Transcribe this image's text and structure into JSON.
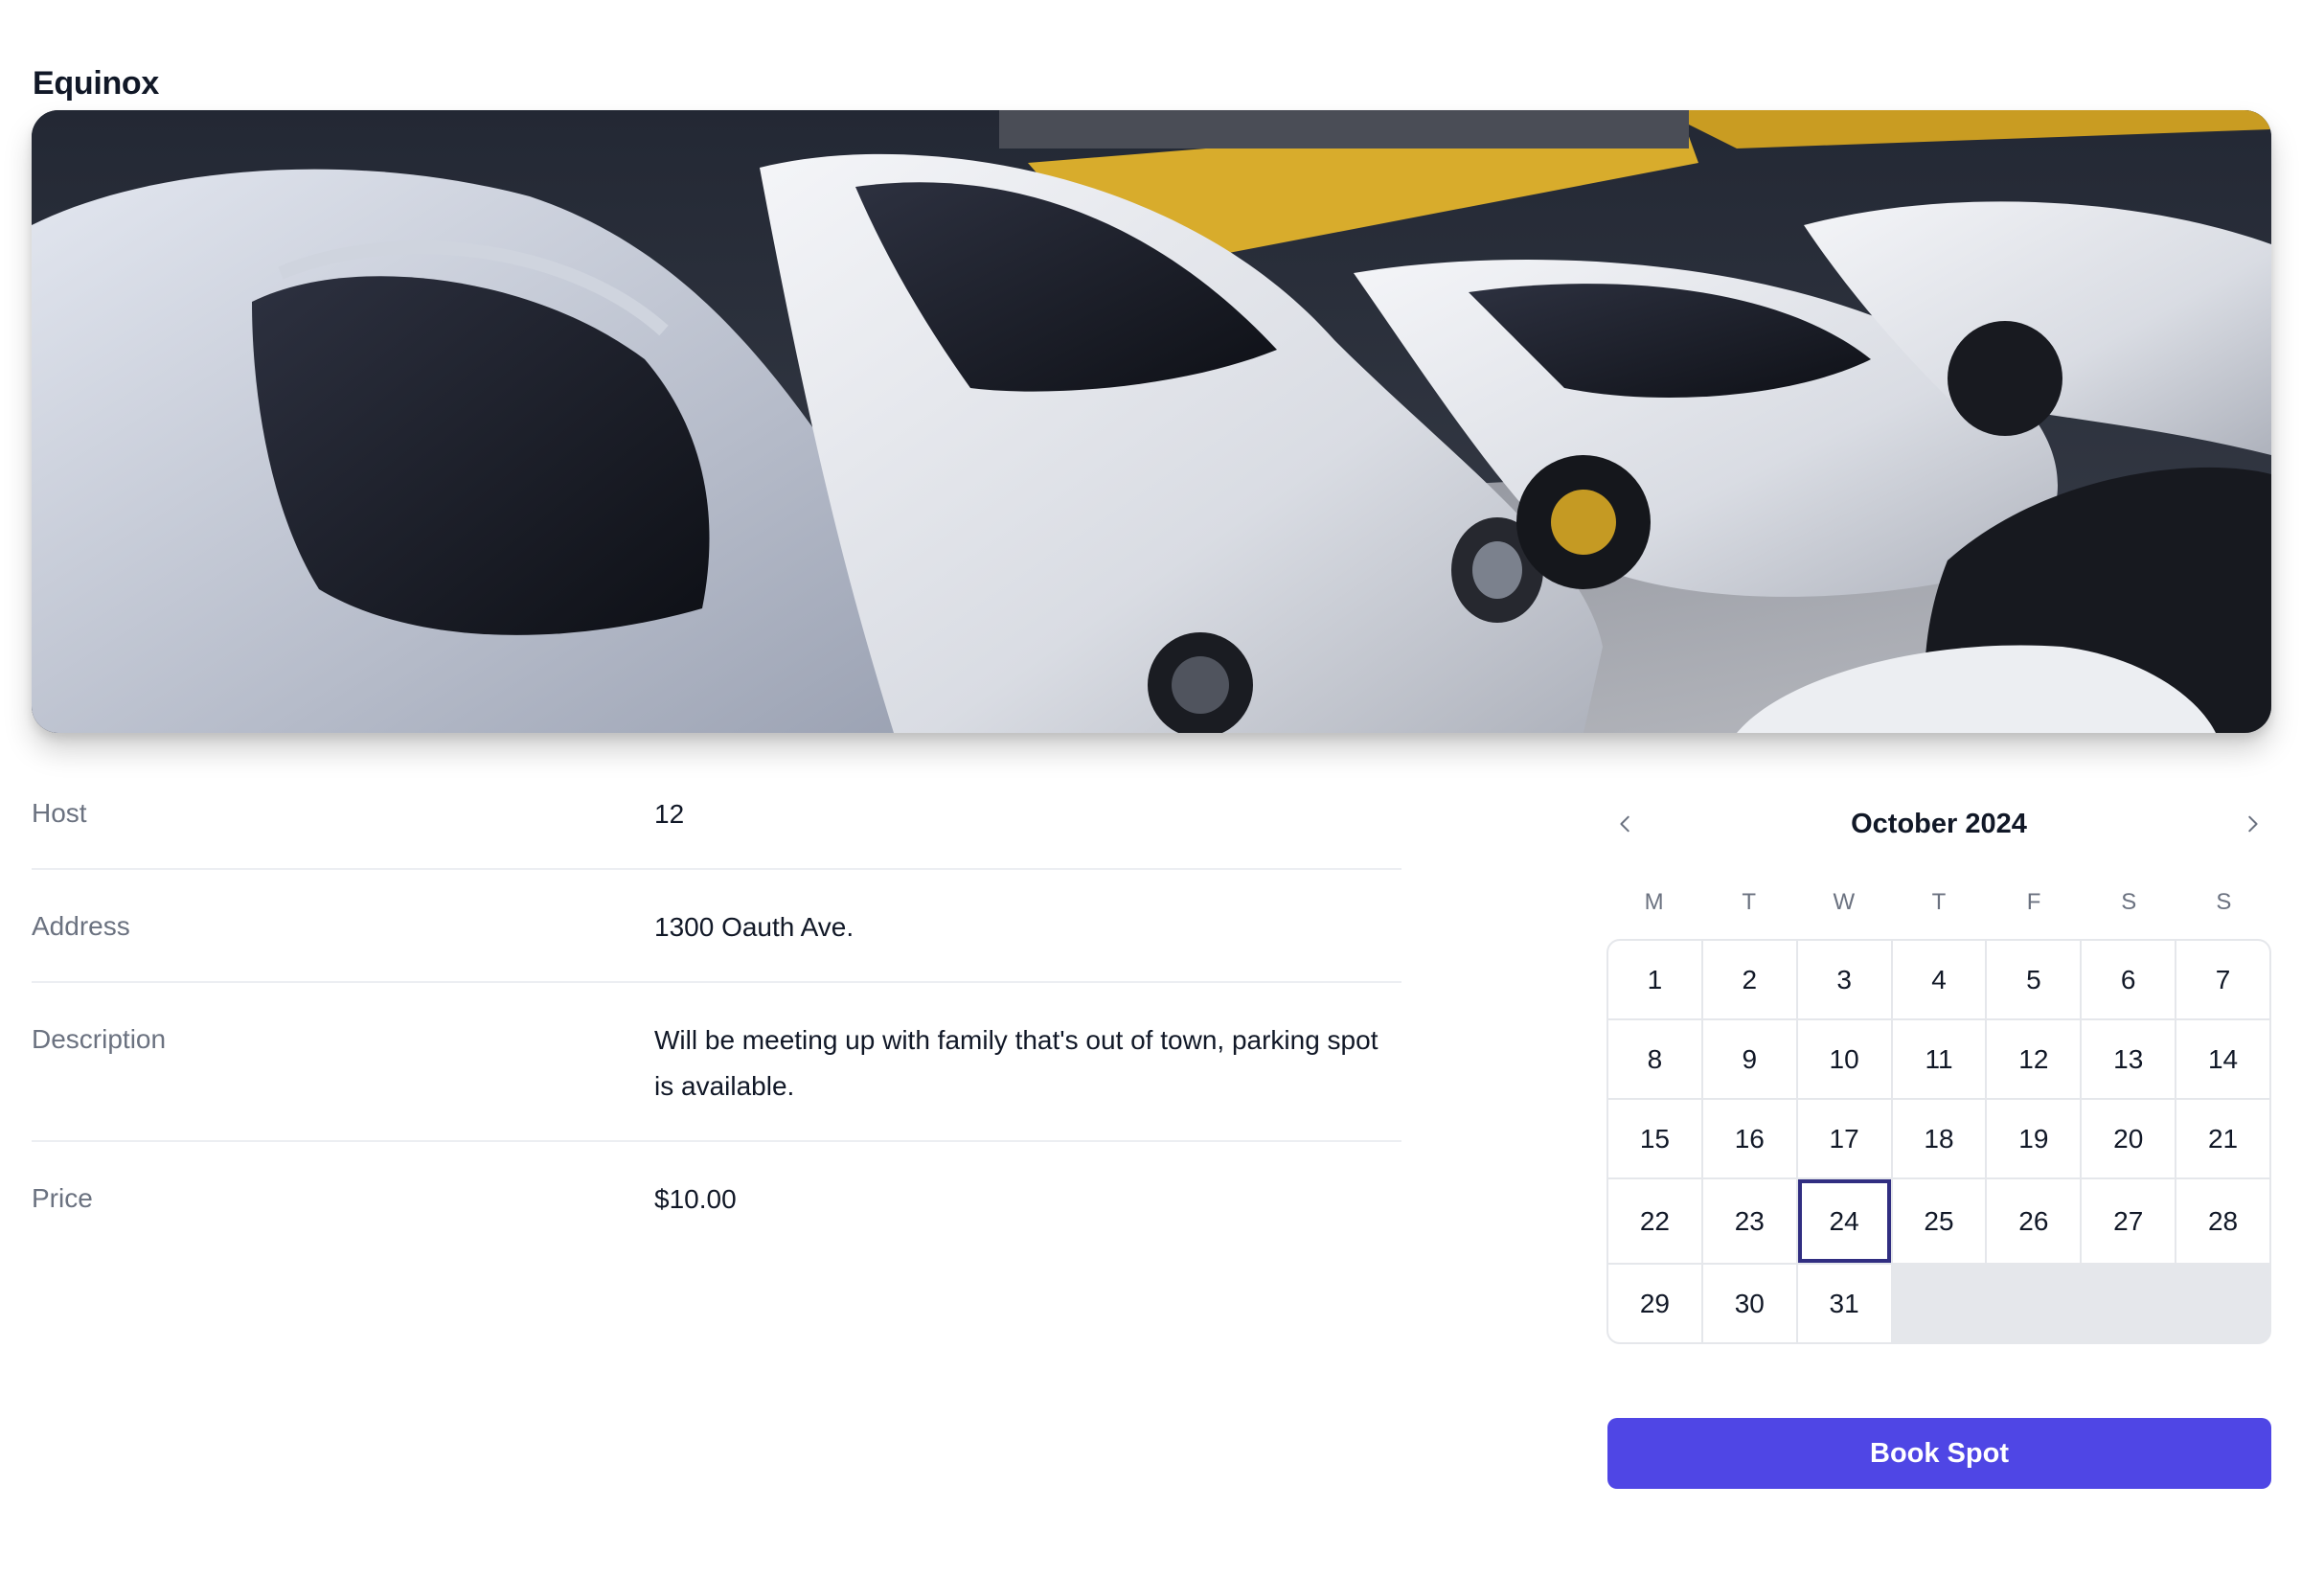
{
  "spot": {
    "title": "Equinox",
    "image_alt": "garage-photo-white-sports-cars"
  },
  "details": [
    {
      "label": "Host",
      "value": "12"
    },
    {
      "label": "Address",
      "value": "1300 Oauth Ave."
    },
    {
      "label": "Description",
      "value": "Will be meeting up with family that's out of town, parking spot is available."
    },
    {
      "label": "Price",
      "value": "$10.00"
    }
  ],
  "calendar": {
    "month_label": "October 2024",
    "prev_icon": "chevron-left-icon",
    "next_icon": "chevron-right-icon",
    "weekdays": [
      "M",
      "T",
      "W",
      "T",
      "F",
      "S",
      "S"
    ],
    "days": [
      "1",
      "2",
      "3",
      "4",
      "5",
      "6",
      "7",
      "8",
      "9",
      "10",
      "11",
      "12",
      "13",
      "14",
      "15",
      "16",
      "17",
      "18",
      "19",
      "20",
      "21",
      "22",
      "23",
      "24",
      "25",
      "26",
      "27",
      "28",
      "29",
      "30",
      "31"
    ],
    "selected_day": "24",
    "selected_color": "#312e81"
  },
  "book_button": {
    "label": "Book Spot",
    "color": "#4f46e5"
  }
}
